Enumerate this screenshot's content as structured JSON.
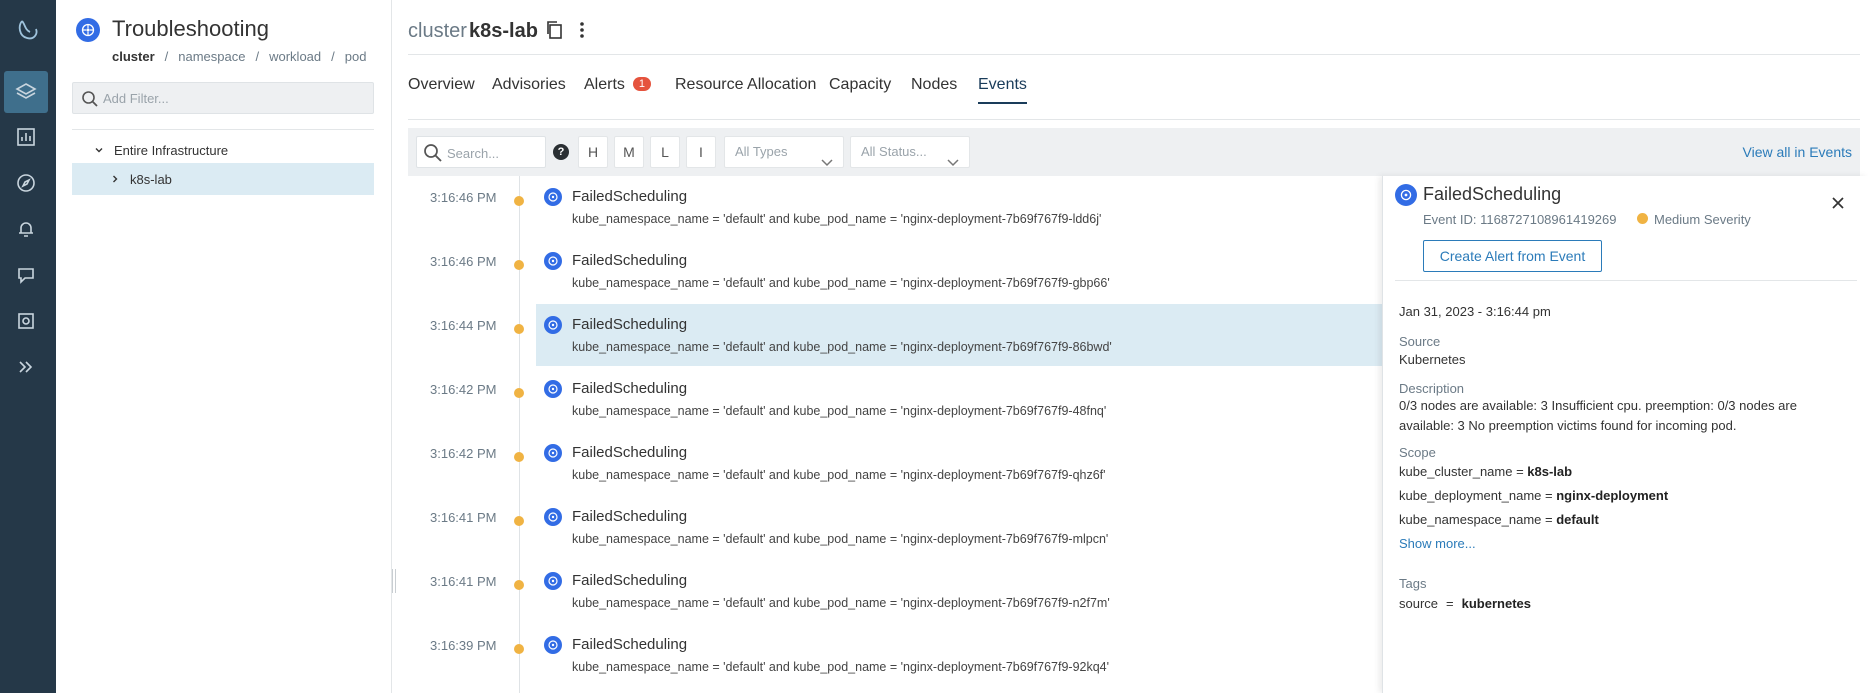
{
  "header": {
    "page_title": "Troubleshooting",
    "breadcrumbs": [
      "cluster",
      "namespace",
      "workload",
      "pod"
    ],
    "breadcrumb_separator": "/",
    "cluster_label": "cluster",
    "cluster_name": "k8s-lab"
  },
  "filter": {
    "placeholder": "Add Filter..."
  },
  "tree": {
    "root": "Entire Infrastructure",
    "child": "k8s-lab"
  },
  "tabs": [
    {
      "label": "Overview"
    },
    {
      "label": "Advisories"
    },
    {
      "label": "Alerts",
      "badge": "1"
    },
    {
      "label": "Resource Allocation"
    },
    {
      "label": "Capacity"
    },
    {
      "label": "Nodes"
    },
    {
      "label": "Events",
      "active": true
    }
  ],
  "toolbar": {
    "search_placeholder": "Search...",
    "help": "?",
    "severity_buttons": [
      "H",
      "M",
      "L",
      "I"
    ],
    "type_dropdown": "All Types",
    "status_dropdown": "All Status...",
    "view_all": "View all in Events"
  },
  "events": [
    {
      "time": "3:16:46 PM",
      "name": "FailedScheduling",
      "desc": "kube_namespace_name = 'default' and kube_pod_name = 'nginx-deployment-7b69f767f9-ldd6j'"
    },
    {
      "time": "3:16:46 PM",
      "name": "FailedScheduling",
      "desc": "kube_namespace_name = 'default' and kube_pod_name = 'nginx-deployment-7b69f767f9-gbp66'"
    },
    {
      "time": "3:16:44 PM",
      "name": "FailedScheduling",
      "desc": "kube_namespace_name = 'default' and kube_pod_name = 'nginx-deployment-7b69f767f9-86bwd'",
      "selected": true
    },
    {
      "time": "3:16:42 PM",
      "name": "FailedScheduling",
      "desc": "kube_namespace_name = 'default' and kube_pod_name = 'nginx-deployment-7b69f767f9-48fnq'"
    },
    {
      "time": "3:16:42 PM",
      "name": "FailedScheduling",
      "desc": "kube_namespace_name = 'default' and kube_pod_name = 'nginx-deployment-7b69f767f9-qhz6f'"
    },
    {
      "time": "3:16:41 PM",
      "name": "FailedScheduling",
      "desc": "kube_namespace_name = 'default' and kube_pod_name = 'nginx-deployment-7b69f767f9-mlpcn'"
    },
    {
      "time": "3:16:41 PM",
      "name": "FailedScheduling",
      "desc": "kube_namespace_name = 'default' and kube_pod_name = 'nginx-deployment-7b69f767f9-n2f7m'"
    },
    {
      "time": "3:16:39 PM",
      "name": "FailedScheduling",
      "desc": "kube_namespace_name = 'default' and kube_pod_name = 'nginx-deployment-7b69f767f9-92kq4'"
    }
  ],
  "detail": {
    "title": "FailedScheduling",
    "event_id": "Event ID: 1168727108961419269",
    "severity": "Medium Severity",
    "create_alert": "Create Alert from Event",
    "timestamp": "Jan 31, 2023 - 3:16:44 pm",
    "source_label": "Source",
    "source": "Kubernetes",
    "description_label": "Description",
    "description": "0/3 nodes are available: 3 Insufficient cpu. preemption: 0/3 nodes are available: 3 No preemption victims found for incoming pod.",
    "scope_label": "Scope",
    "scope": [
      {
        "key": "kube_cluster_name = ",
        "value": "k8s-lab"
      },
      {
        "key": "kube_deployment_name = ",
        "value": "nginx-deployment"
      },
      {
        "key": "kube_namespace_name = ",
        "value": "default"
      }
    ],
    "show_more": "Show more...",
    "tags_label": "Tags",
    "tags": [
      {
        "key": "source",
        "eq": "=",
        "value": "kubernetes"
      }
    ]
  },
  "colors": {
    "rail": "#253848",
    "accent": "#2b7bb9",
    "selected_row": "#dbebf3",
    "medium_severity": "#f0b343",
    "alert_badge": "#e5533d",
    "kubernetes": "#326ce5"
  }
}
